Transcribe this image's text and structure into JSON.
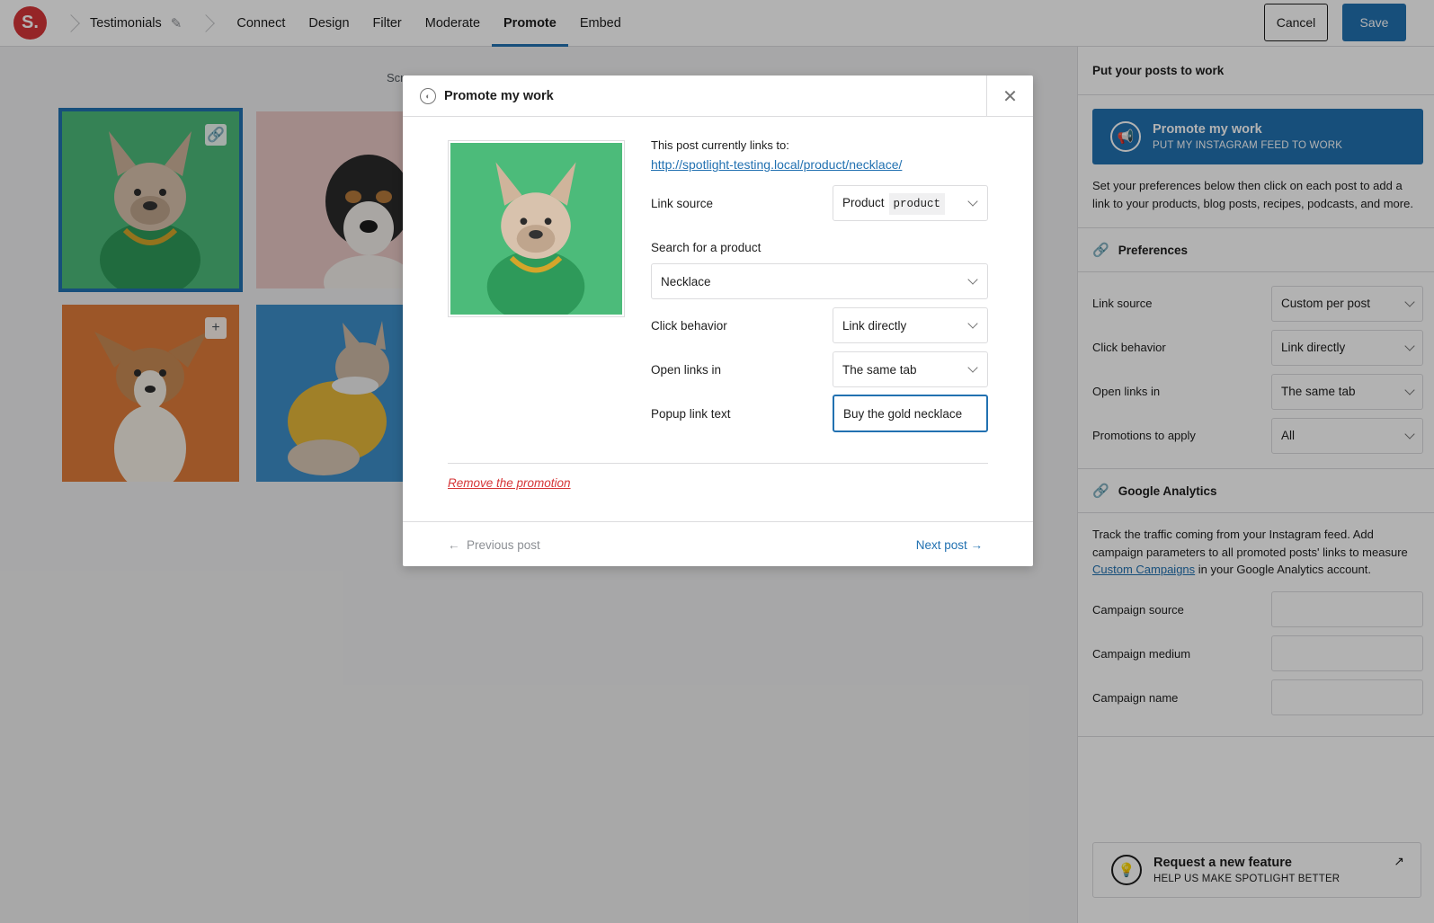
{
  "topbar": {
    "logo_text": "S.",
    "feed_name": "Testimonials",
    "tabs": [
      {
        "label": "Connect"
      },
      {
        "label": "Design"
      },
      {
        "label": "Filter"
      },
      {
        "label": "Moderate"
      },
      {
        "label": "Promote"
      },
      {
        "label": "Embed"
      }
    ],
    "active_tab": "Promote",
    "cancel_label": "Cancel",
    "save_label": "Save"
  },
  "main": {
    "grid_caption": "Scr",
    "thumbnails": [
      {
        "subject": "French bulldog in green jacket with gold chain",
        "bg": "#4cbb7a",
        "action_icon": "link-icon",
        "selected": true
      },
      {
        "subject": "Tricolor dog on pink background",
        "bg": "#e8c8c5",
        "action_icon": "",
        "selected": false
      },
      {
        "subject": "Corgi puppy on orange background",
        "bg": "#e07b3a",
        "action_icon": "plus-icon",
        "selected": false
      },
      {
        "subject": "French bulldog in yellow hoodie on blue background",
        "bg": "#3d8fc9",
        "action_icon": "",
        "selected": false
      }
    ]
  },
  "modal": {
    "title": "Promote my work",
    "links_to_label": "This post currently links to:",
    "links_to_url": "http://spotlight-testing.local/product/necklace/",
    "link_source_label": "Link source",
    "link_source_value": "Product",
    "link_source_code": "product",
    "search_label": "Search for a product",
    "search_value": "Necklace",
    "click_behavior_label": "Click behavior",
    "click_behavior_value": "Link directly",
    "open_links_label": "Open links in",
    "open_links_value": "The same tab",
    "popup_text_label": "Popup link text",
    "popup_text_value": "Buy the gold necklace",
    "remove_label": "Remove the promotion",
    "prev_label": "Previous post",
    "next_label": "Next post"
  },
  "sidebar": {
    "header": "Put your posts to work",
    "promote_card": {
      "title": "Promote my work",
      "subtitle": "PUT MY INSTAGRAM FEED TO WORK"
    },
    "intro": "Set your preferences below then click on each post to add a link to your products, blog posts, recipes, podcasts, and more.",
    "preferences": {
      "title": "Preferences",
      "rows": [
        {
          "label": "Link source",
          "value": "Custom per post"
        },
        {
          "label": "Click behavior",
          "value": "Link directly"
        },
        {
          "label": "Open links in",
          "value": "The same tab"
        },
        {
          "label": "Promotions to apply",
          "value": "All"
        }
      ]
    },
    "analytics": {
      "title": "Google Analytics",
      "text_before": "Track the traffic coming from your Instagram feed. Add campaign parameters to all promoted posts' links to measure ",
      "link": "Custom Campaigns",
      "text_after": " in your Google Analytics account.",
      "fields": [
        {
          "label": "Campaign source",
          "value": ""
        },
        {
          "label": "Campaign medium",
          "value": ""
        },
        {
          "label": "Campaign name",
          "value": ""
        }
      ]
    },
    "feature_card": {
      "title": "Request a new feature",
      "subtitle": "HELP US MAKE SPOTLIGHT BETTER"
    }
  },
  "colors": {
    "accent": "#2271b1",
    "danger": "#d63638",
    "overlay": "rgba(0,0,0,0.30)"
  }
}
